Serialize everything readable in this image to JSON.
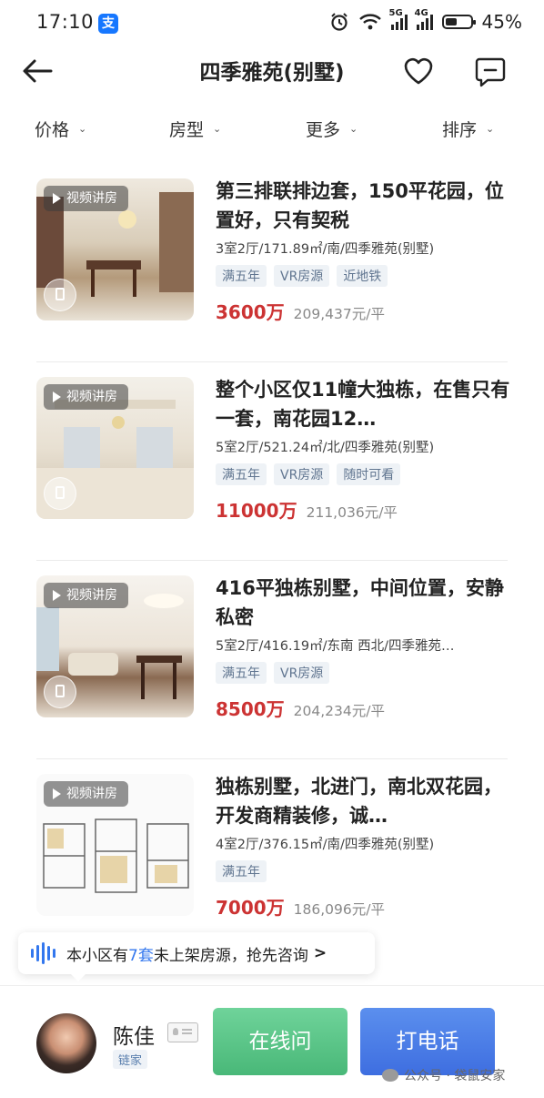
{
  "status_bar": {
    "time": "17:10",
    "alipay_icon": "支",
    "net1": "5G",
    "net2": "4G",
    "battery": "45%",
    "battery_level": 0.45
  },
  "nav": {
    "title": "四季雅苑(别墅)"
  },
  "filters": [
    "价格",
    "房型",
    "更多",
    "排序"
  ],
  "listings": [
    {
      "title": "第三排联排边套，150平花园，位置好，只有契税",
      "detail": "3室2厅/171.89㎡/南/四季雅苑(别墅)",
      "tags": [
        "满五年",
        "VR房源",
        "近地铁"
      ],
      "price": "3600万",
      "unit_price": "209,437元/平",
      "badge": "视频讲房"
    },
    {
      "title": "整个小区仅11幢大独栋，在售只有一套，南花园12…",
      "detail": "5室2厅/521.24㎡/北/四季雅苑(别墅)",
      "tags": [
        "满五年",
        "VR房源",
        "随时可看"
      ],
      "price": "11000万",
      "unit_price": "211,036元/平",
      "badge": "视频讲房"
    },
    {
      "title": "416平独栋别墅，中间位置，安静私密",
      "detail": "5室2厅/416.19㎡/东南 西北/四季雅苑…",
      "tags": [
        "满五年",
        "VR房源"
      ],
      "price": "8500万",
      "unit_price": "204,234元/平",
      "badge": "视频讲房"
    },
    {
      "title": "独栋别墅，北进门，南北双花园，开发商精装修，诚…",
      "detail": "4室2厅/376.15㎡/南/四季雅苑(别墅)",
      "tags": [
        "满五年"
      ],
      "price": "7000万",
      "unit_price": "186,096元/平",
      "badge": "视频讲房"
    }
  ],
  "banner": {
    "pre": "本小区有",
    "count": "7套",
    "post": "未上架房源，抢先咨询"
  },
  "agent": {
    "name": "陈佳",
    "company": "链家"
  },
  "actions": {
    "online": "在线问",
    "call": "打电话"
  },
  "watermark": "公众号 · 袋鼠安家",
  "colors": {
    "price_red": "#cc3333",
    "accent_blue": "#3377ee",
    "online_green": "#49b878",
    "call_blue": "#3e6ee0"
  }
}
